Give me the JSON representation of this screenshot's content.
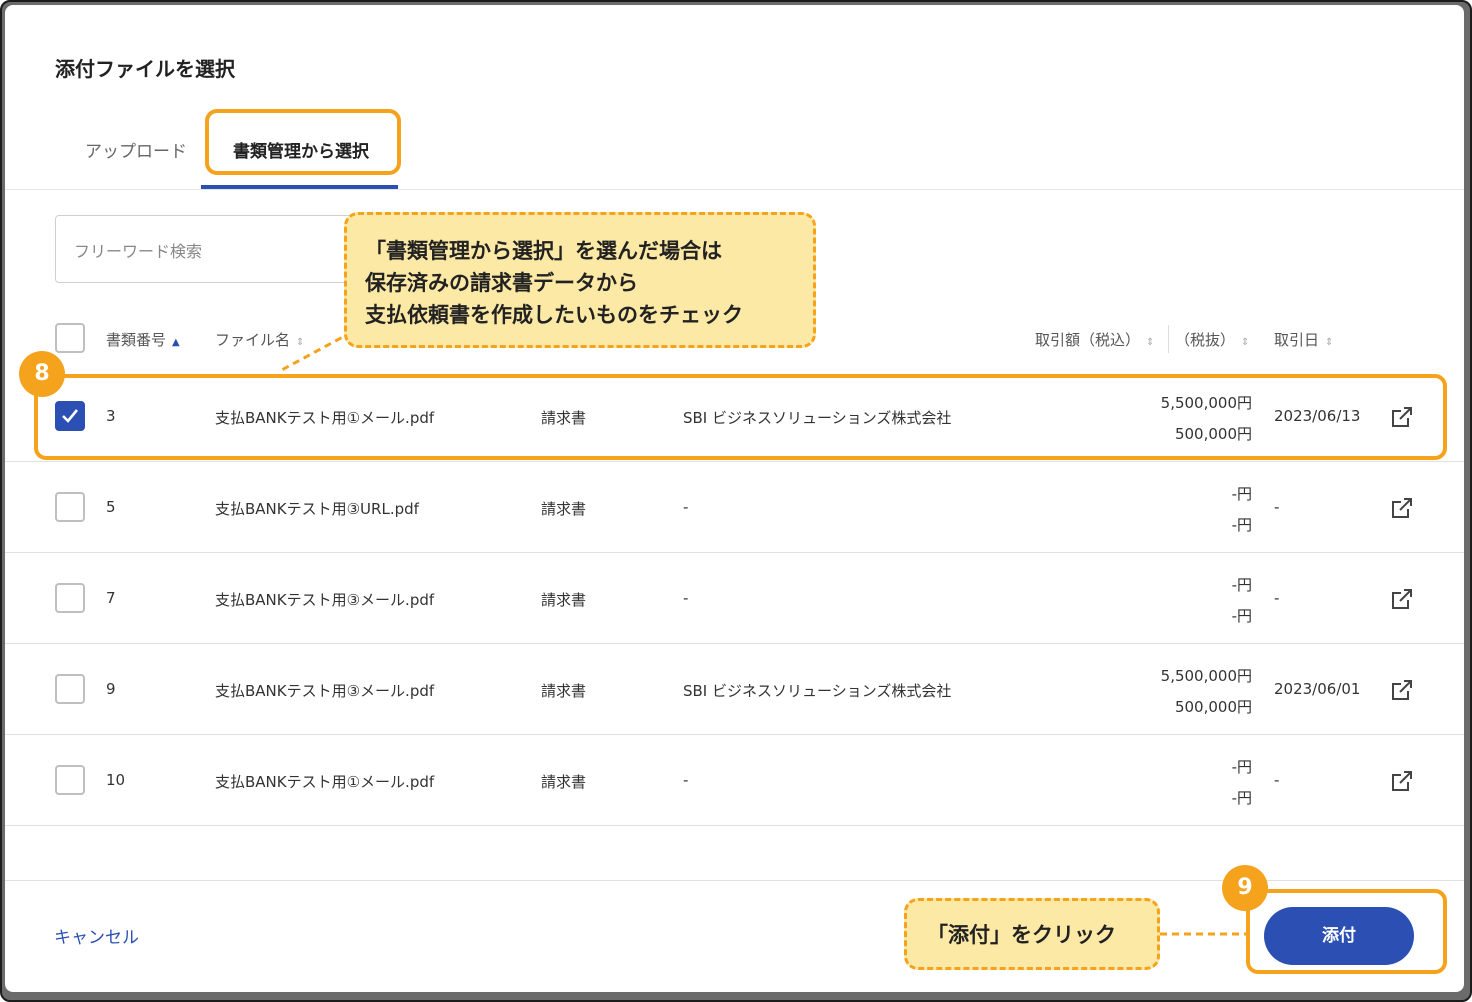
{
  "dialog": {
    "title": "添付ファイルを選択",
    "tabs": [
      {
        "label": "アップロード",
        "active": false
      },
      {
        "label": "書類管理から選択",
        "active": true
      }
    ],
    "search_placeholder": "フリーワード検索"
  },
  "table": {
    "headers": {
      "doc_number": "書類番号",
      "file_name": "ファイル名",
      "amount_incl": "取引額（税込）",
      "amount_excl": "（税抜）",
      "trade_date": "取引日"
    },
    "rows": [
      {
        "checked": true,
        "number": "3",
        "file": "支払BANKテスト用①メール.pdf",
        "type": "請求書",
        "partner": "SBI ビジネスソリューションズ株式会社",
        "amount_incl": "5,500,000円",
        "amount_excl": "500,000円",
        "date": "2023/06/13"
      },
      {
        "checked": false,
        "number": "5",
        "file": "支払BANKテスト用③URL.pdf",
        "type": "請求書",
        "partner": "-",
        "amount_incl": "-円",
        "amount_excl": "-円",
        "date": "-"
      },
      {
        "checked": false,
        "number": "7",
        "file": "支払BANKテスト用③メール.pdf",
        "type": "請求書",
        "partner": "-",
        "amount_incl": "-円",
        "amount_excl": "-円",
        "date": "-"
      },
      {
        "checked": false,
        "number": "9",
        "file": "支払BANKテスト用③メール.pdf",
        "type": "請求書",
        "partner": "SBI ビジネスソリューションズ株式会社",
        "amount_incl": "5,500,000円",
        "amount_excl": "500,000円",
        "date": "2023/06/01"
      },
      {
        "checked": false,
        "number": "10",
        "file": "支払BANKテスト用①メール.pdf",
        "type": "請求書",
        "partner": "-",
        "amount_incl": "-円",
        "amount_excl": "-円",
        "date": "-"
      }
    ]
  },
  "footer": {
    "cancel_label": "キャンセル",
    "attach_label": "添付"
  },
  "annotations": {
    "step8": {
      "badge": "8",
      "lines": [
        "「書類管理から選択」を選んだ場合は",
        "保存済みの請求書データから",
        "支払依頼書を作成したいものをチェック"
      ]
    },
    "step9": {
      "badge": "9",
      "text": "「添付」をクリック"
    }
  },
  "colors": {
    "primary": "#2b4fb3",
    "annotation_orange": "#f5a21d",
    "annotation_fill": "#fde9a6"
  },
  "icons": {
    "checkbox_checked": "check-icon",
    "open_external": "external-link-icon"
  }
}
